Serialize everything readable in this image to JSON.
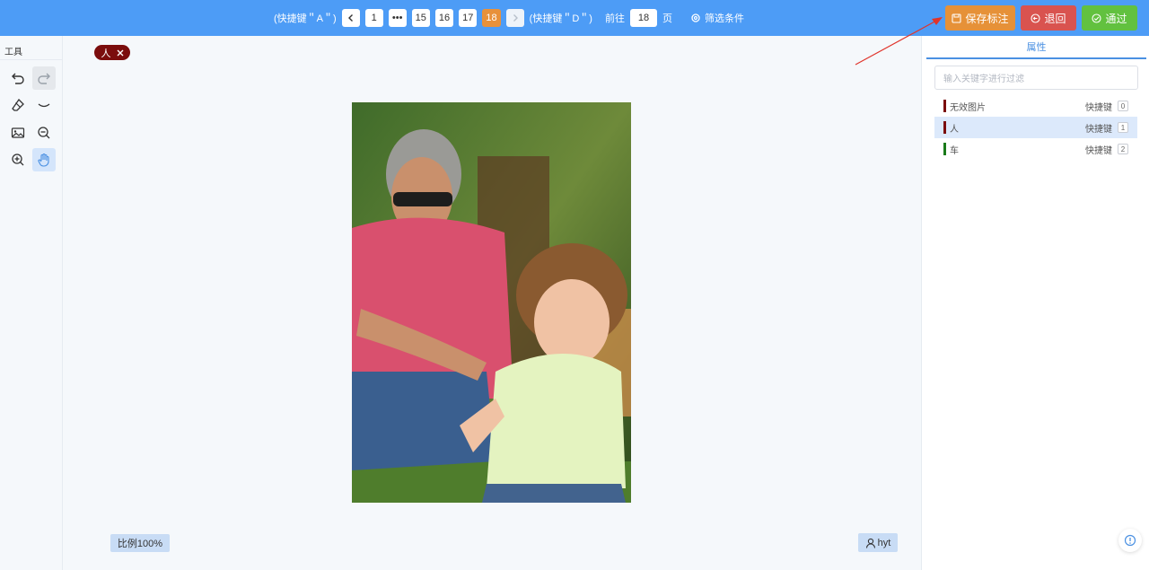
{
  "topbar": {
    "prev_hint": "(快捷键＂A＂)",
    "next_hint": "(快捷键＂D＂)",
    "pages": [
      "1",
      "•••",
      "15",
      "16",
      "17",
      "18"
    ],
    "current_page": "18",
    "goto_label": "前往",
    "goto_value": "18",
    "page_suffix": "页",
    "filter_label": "筛选条件",
    "save_label": "保存标注",
    "back_label": "退回",
    "pass_label": "通过"
  },
  "tools": {
    "title": "工具"
  },
  "canvas": {
    "active_tag": "人",
    "scale_label": "比例100%",
    "user": "hyt"
  },
  "panel": {
    "tab_label": "属性",
    "search_placeholder": "输入关键字进行过滤",
    "shortcut_label": "快捷键",
    "labels": [
      {
        "name": "无效图片",
        "key": "0",
        "color": "#7b0d0d"
      },
      {
        "name": "人",
        "key": "1",
        "color": "#7b0d0d",
        "selected": true
      },
      {
        "name": "车",
        "key": "2",
        "color": "#1a7a1a"
      }
    ]
  },
  "colors": {
    "topbar": "#4d9cf6",
    "save": "#e69138",
    "back": "#d9534f",
    "pass": "#62c13f",
    "active_page": "#e8913a",
    "annotation_arrow": "#e0342b"
  }
}
